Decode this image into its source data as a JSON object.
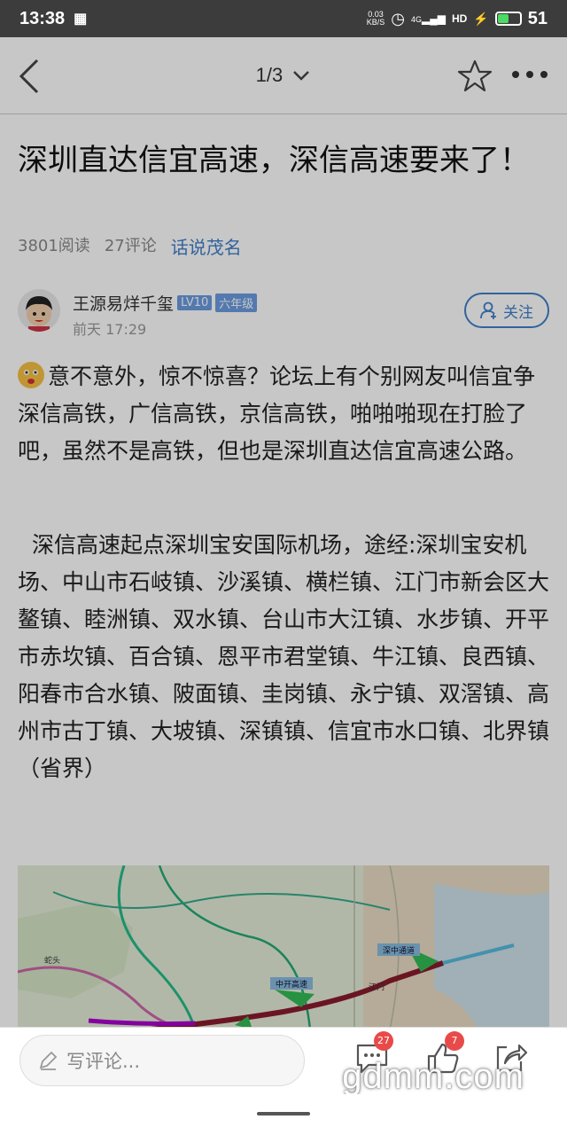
{
  "status_bar": {
    "time": "13:38",
    "speed_top": "0.03",
    "speed_bottom": "KB/S",
    "network": "4G",
    "hd": "HD",
    "battery": "51",
    "battery_level_percent": 51
  },
  "topbar": {
    "pager": "1/3"
  },
  "article": {
    "title": "深圳直达信宜高速，深信高速要来了！",
    "reads": "3801阅读",
    "comments": "27评论",
    "topic": "话说茂名"
  },
  "author": {
    "name": "王源易烊千玺",
    "level": "LV10",
    "grade": "六年级",
    "time": "前天 17:29",
    "follow_label": "关注"
  },
  "body": {
    "para1": "意不意外，惊不惊喜？论坛上有个别网友叫信宜争深信高铁，广信高铁，京信高铁，啪啪啪现在打脸了吧，虽然不是高铁，但也是深圳直达信宜高速公路。",
    "para2": "深信高速起点深圳宝安国际机场，途经:深圳宝安机场、中山市石岐镇、沙溪镇、横栏镇、江门市新会区大鳌镇、睦洲镇、双水镇、台山市大江镇、水步镇、开平市赤坎镇、百合镇、恩平市君堂镇、牛江镇、良西镇、阳春市合水镇、陂面镇、圭岗镇、永宁镇、双滘镇、高州市古丁镇、大坡镇、深镇镇、信宜市水口镇、北界镇（省界）"
  },
  "map": {
    "label_1": "深中通道",
    "label_2": "中开高速",
    "label_3": "蛇头",
    "label_4": "江门"
  },
  "bottom": {
    "comment_placeholder": "写评论...",
    "comment_count": "27",
    "like_count": "7"
  },
  "watermark": "gdmm.com",
  "colors": {
    "accent": "#3f7fc9",
    "badge": "#e84a4a",
    "status_bar": "#3c3c3c"
  }
}
